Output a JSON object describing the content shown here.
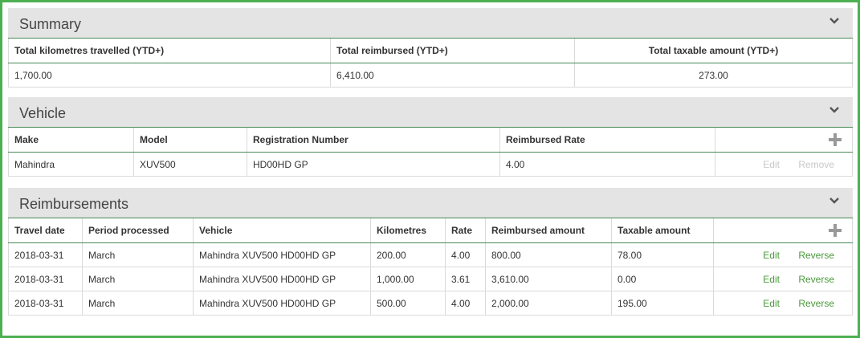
{
  "summary": {
    "title": "Summary",
    "headers": [
      "Total kilometres travelled (YTD+)",
      "Total reimbursed (YTD+)",
      "Total taxable amount (YTD+)"
    ],
    "row": [
      "1,700.00",
      "6,410.00",
      "273.00"
    ]
  },
  "vehicle": {
    "title": "Vehicle",
    "headers": [
      "Make",
      "Model",
      "Registration Number",
      "Reimbursed Rate"
    ],
    "rows": [
      {
        "cells": [
          "Mahindra",
          "XUV500",
          "HD00HD GP",
          "4.00"
        ],
        "edit": "Edit",
        "remove": "Remove"
      }
    ]
  },
  "reimbursements": {
    "title": "Reimbursements",
    "headers": [
      "Travel date",
      "Period processed",
      "Vehicle",
      "Kilometres",
      "Rate",
      "Reimbursed amount",
      "Taxable amount"
    ],
    "rows": [
      {
        "cells": [
          "2018-03-31",
          "March",
          "Mahindra XUV500 HD00HD GP",
          "200.00",
          "4.00",
          "800.00",
          "78.00"
        ],
        "edit": "Edit",
        "reverse": "Reverse"
      },
      {
        "cells": [
          "2018-03-31",
          "March",
          "Mahindra XUV500 HD00HD GP",
          "1,000.00",
          "3.61",
          "3,610.00",
          "0.00"
        ],
        "edit": "Edit",
        "reverse": "Reverse"
      },
      {
        "cells": [
          "2018-03-31",
          "March",
          "Mahindra XUV500 HD00HD GP",
          "500.00",
          "4.00",
          "2,000.00",
          "195.00"
        ],
        "edit": "Edit",
        "reverse": "Reverse"
      }
    ]
  },
  "icons": {
    "collapse": "chevron-down-icon",
    "add": "plus-icon"
  },
  "colors": {
    "border": "#4caf50",
    "action": "#4a9a3a",
    "disabled": "#c8c8c8",
    "header_bg": "#e4e4e4"
  }
}
